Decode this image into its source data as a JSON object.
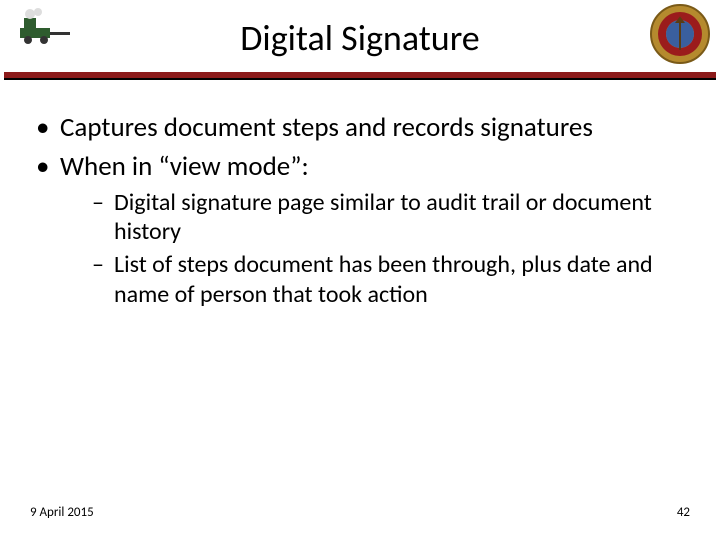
{
  "title": "Digital Signature",
  "bullets": [
    {
      "text": "Captures document steps and records signatures"
    },
    {
      "text": "When in “view mode”:",
      "subs": [
        "Digital signature page similar to audit trail or document history",
        "List of steps document has been through, plus date and name of person that took action"
      ]
    }
  ],
  "footer": {
    "date": "9 April 2015",
    "page": "42"
  },
  "colors": {
    "divider": "#8b1a1a"
  },
  "icons": {
    "left": "train-icon",
    "right": "usmc-seal-icon"
  }
}
